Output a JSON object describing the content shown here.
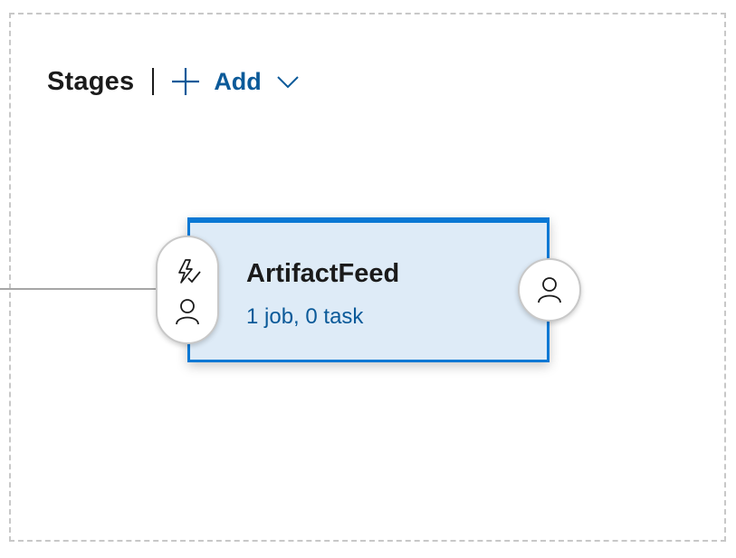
{
  "header": {
    "title": "Stages",
    "add_label": "Add"
  },
  "stage": {
    "name": "ArtifactFeed",
    "summary": "1 job, 0 task"
  },
  "icons": {
    "add": "plus-icon",
    "add_menu": "chevron-down-icon",
    "pre_trigger": "lightning-check-icon",
    "pre_approval": "person-icon",
    "post_approval": "person-icon"
  },
  "colors": {
    "accent": "#0a78d4",
    "link": "#0b5a99",
    "card_background": "#deebf7",
    "text": "#1b1b1b"
  }
}
